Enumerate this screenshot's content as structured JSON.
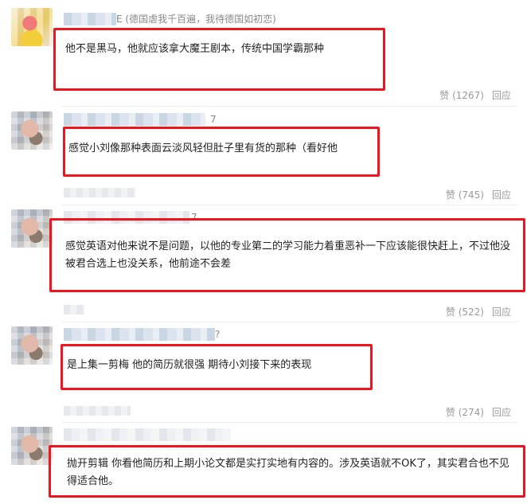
{
  "comments": [
    {
      "name_suffix": "E (德国虐我千百遍，我待德国如初恋)",
      "text": "他不是黑马，他就应该拿大魔王剧本，传统中国学霸那种",
      "likes": "赞 (1267)",
      "reply": "回应"
    },
    {
      "name_suffix": "7",
      "text": "感觉小刘像那种表面云淡风轻但肚子里有货的那种（看好他",
      "likes": "赞 (745)",
      "reply": "回应"
    },
    {
      "name_suffix": "7",
      "text": "感觉英语对他来说不是问题，以他的专业第二的学习能力着重恶补一下应该能很快赶上，不过他没被君合选上也没关系，他前途不会差",
      "likes": "赞 (522)",
      "reply": "回应"
    },
    {
      "name_suffix": "?",
      "text": "是上集一剪梅 他的简历就很强 期待小刘接下来的表现",
      "likes": "赞 (274)",
      "reply": "回应"
    },
    {
      "name_suffix": "",
      "text": "抛开剪辑 你看他简历和上期小论文都是实打实地有内容的。涉及英语就不OK了，其实君合也不见得适合他。"
    }
  ],
  "colors": {
    "highlight": "#f0141e",
    "meta": "#9a9a9a"
  }
}
